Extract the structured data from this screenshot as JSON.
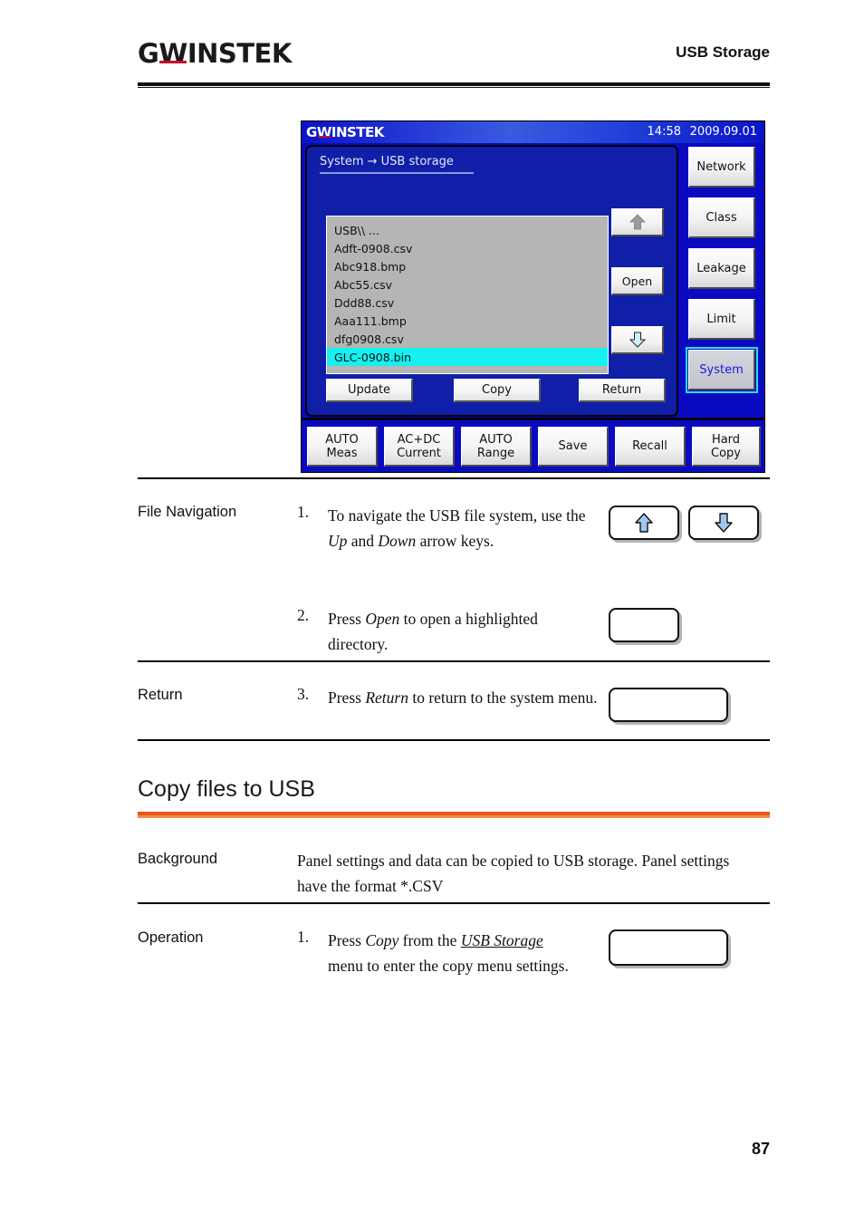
{
  "header": {
    "brand_gw": "G",
    "brand_w": "W",
    "brand_rest": "INSTEK",
    "title": "USB Storage"
  },
  "instrument": {
    "brand_gw": "G",
    "brand_w": "W",
    "brand_rest": "INSTEK",
    "time": "14:58",
    "date": "2009.09.01",
    "breadcrumb": "System → USB storage",
    "file_list": [
      {
        "name": "USB\\\\ ...",
        "selected": false
      },
      {
        "name": "Adft-0908.csv",
        "selected": false
      },
      {
        "name": "Abc918.bmp",
        "selected": false
      },
      {
        "name": "Abc55.csv",
        "selected": false
      },
      {
        "name": "Ddd88.csv",
        "selected": false
      },
      {
        "name": "Aaa111.bmp",
        "selected": false
      },
      {
        "name": "dfg0908.csv",
        "selected": false
      },
      {
        "name": "GLC-0908.bin",
        "selected": true
      }
    ],
    "side_buttons": {
      "up": "up-arrow-icon",
      "open": "Open",
      "down": "down-arrow-icon"
    },
    "main_buttons": {
      "update": "Update",
      "copy": "Copy",
      "return": "Return"
    },
    "softkeys": [
      {
        "label": "Network",
        "active": false
      },
      {
        "label": "Class",
        "active": false
      },
      {
        "label": "Leakage",
        "active": false
      },
      {
        "label": "Limit",
        "active": false
      },
      {
        "label": "System",
        "active": true
      }
    ],
    "function_keys": [
      {
        "line1": "AUTO",
        "line2": "Meas"
      },
      {
        "line1": "AC+DC",
        "line2": "Current"
      },
      {
        "line1": "AUTO",
        "line2": "Range"
      },
      {
        "line1": "Save",
        "line2": ""
      },
      {
        "line1": "Recall",
        "line2": ""
      },
      {
        "line1": "Hard",
        "line2": "Copy"
      }
    ],
    "colors": {
      "screen_blue": "#0a0ac0",
      "panel_blue": "#0f1fa8",
      "selection_cyan": "#16f0f0",
      "active_softkey_text": "#1a1ae0"
    }
  },
  "sections": {
    "file_navigation": {
      "label": "File Navigation",
      "step1_num": "1.",
      "step1_text_a": "To navigate the USB file system, use the ",
      "step1_em_up": "Up",
      "step1_text_b": " and ",
      "step1_em_down": "Down",
      "step1_text_c": " arrow keys.",
      "step2_num": "2.",
      "step2_text_a": "Press ",
      "step2_em": "Open",
      "step2_text_b": " to open a highlighted directory.",
      "key_up": "up-arrow-key",
      "key_down": "down-arrow-key",
      "key_open": "open-key"
    },
    "return": {
      "label": "Return",
      "step3_num": "3.",
      "step3_text_a": "Press ",
      "step3_em": "Return",
      "step3_text_b": " to return to the system menu.",
      "key_return": "return-key"
    },
    "copy_files": {
      "heading": "Copy files to USB",
      "rule_color_dark": "#e8561b",
      "rule_color_light": "#f58b4c",
      "background_label": "Background",
      "background_text": "Panel settings and data can be copied to USB storage. Panel settings have the format *.CSV",
      "operation_label": "Operation",
      "op1_num": "1.",
      "op1_text_a": "Press ",
      "op1_em": "Copy",
      "op1_text_b": " from the ",
      "op1_u": "USB Storage",
      "op1_text_c": " menu to enter the copy menu settings.",
      "key_copy": "copy-key"
    }
  },
  "footer": {
    "page_number": "87"
  }
}
